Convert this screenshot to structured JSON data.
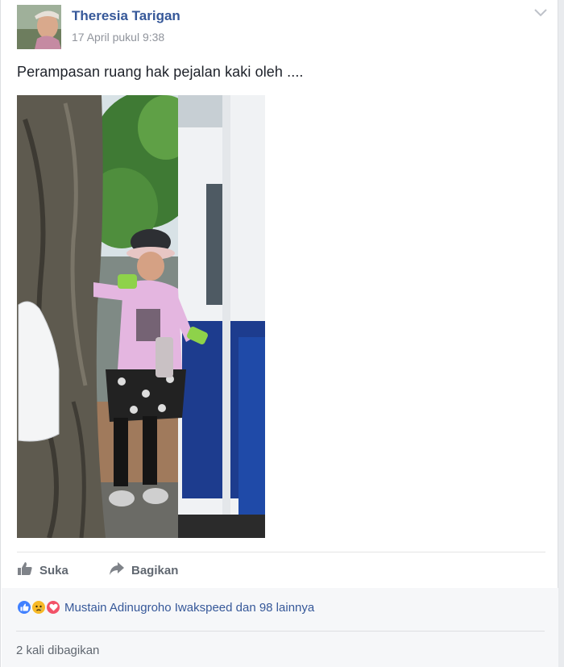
{
  "post": {
    "author": "Theresia Tarigan",
    "timestamp": "17 April pukul 9:38",
    "text": "Perampasan ruang hak pejalan kaki oleh ....",
    "icons": {
      "menu": "chevron-down-icon"
    }
  },
  "actions": {
    "like_label": "Suka",
    "like_icon": "thumbs-up-icon",
    "share_label": "Bagikan",
    "share_icon": "share-arrow-icon"
  },
  "reactions": {
    "icons": [
      "like-reaction-icon",
      "sad-reaction-icon",
      "love-reaction-icon"
    ],
    "summary": "Mustain Adinugroho Iwakspeed dan 98 lainnya"
  },
  "shares": {
    "text": "2 kali dibagikan"
  },
  "colors": {
    "link_blue": "#365899",
    "meta_gray": "#90949c",
    "action_gray": "#606770",
    "like_blue": "#4080ff",
    "sad_yellow": "#f7b928",
    "love_red": "#f25268"
  }
}
